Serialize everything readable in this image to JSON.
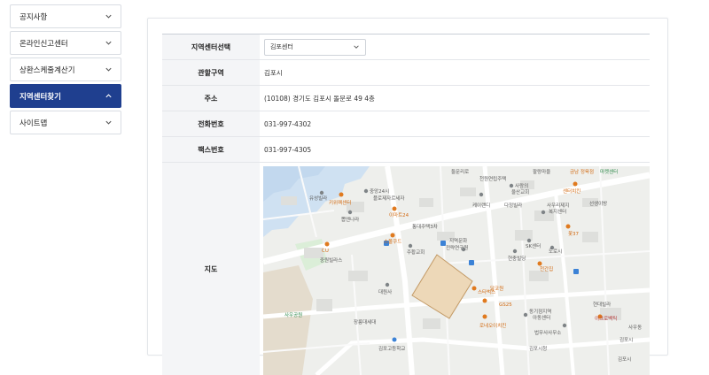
{
  "sidebar": {
    "items": [
      {
        "label": "공지사항",
        "active": false,
        "chevron": "chevron-down-icon"
      },
      {
        "label": "온라인신고센터",
        "active": false,
        "chevron": "chevron-down-icon"
      },
      {
        "label": "상환스케줄계산기",
        "active": false,
        "chevron": "chevron-down-icon"
      },
      {
        "label": "지역센터찾기",
        "active": true,
        "chevron": "chevron-up-icon"
      },
      {
        "label": "사이트맵",
        "active": false,
        "chevron": "chevron-down-icon"
      }
    ]
  },
  "colors": {
    "accent": "#1f3f8f",
    "header_bg": "#f4f5f7",
    "border": "#e4e6ea"
  },
  "info": {
    "center_select": {
      "label": "지역센터선택",
      "value": "김포센터"
    },
    "jurisdiction": {
      "label": "관할구역",
      "value": "김포시"
    },
    "address": {
      "label": "주소",
      "value": "(10108) 경기도 김포시 돌문로 49 4층"
    },
    "phone": {
      "label": "전화번호",
      "value": "031-997-4302"
    },
    "fax": {
      "label": "팩스번호",
      "value": "031-997-4305"
    },
    "map": {
      "label": "지도"
    }
  },
  "map_labels": {
    "l1": "유성빌라",
    "l2": "키위렉센터",
    "l3": "중앙24시",
    "l4": "플로제자르세자",
    "l5": "이마트24",
    "l6": "뽑엔나라",
    "l7": "통대주택3차",
    "l8": "스몰쿠드",
    "l9": "CU",
    "l10": "중원빌라스",
    "l11": "주황교회",
    "l12": "지역문화",
    "l13": "전략연구원",
    "l14": "대원사",
    "l15": "장릉대세대",
    "l16": "김포고등학교",
    "l17": "케이랜디",
    "l18": "다정빌라",
    "l19": "사랑의",
    "l20": "울산교회",
    "l21": "사우리제지",
    "l22": "복지센터",
    "l23": "선생이방",
    "l24": "천원연립주택",
    "l25": "팔랑마을",
    "l26": "금남 정육점",
    "l27": "마켓센터",
    "l28": "센터치킨",
    "l29": "SK센터",
    "l30": "도로시",
    "l31": "스타벅스",
    "l32": "달코원",
    "l33": "GS25",
    "l34": "로네오이치킨",
    "l35": "천간집",
    "l36": "현충빌딩",
    "l37": "꽃37",
    "l38": "김포시청",
    "l39": "동기점지역",
    "l40": "아동센터",
    "l41": "현대빌라",
    "l42": "이크로벡틱",
    "l43": "법무사사무소",
    "l44": "사우동",
    "l45": "김포시",
    "l46": "둘문리로",
    "l47": "김포시",
    "l48": "사우공원"
  }
}
